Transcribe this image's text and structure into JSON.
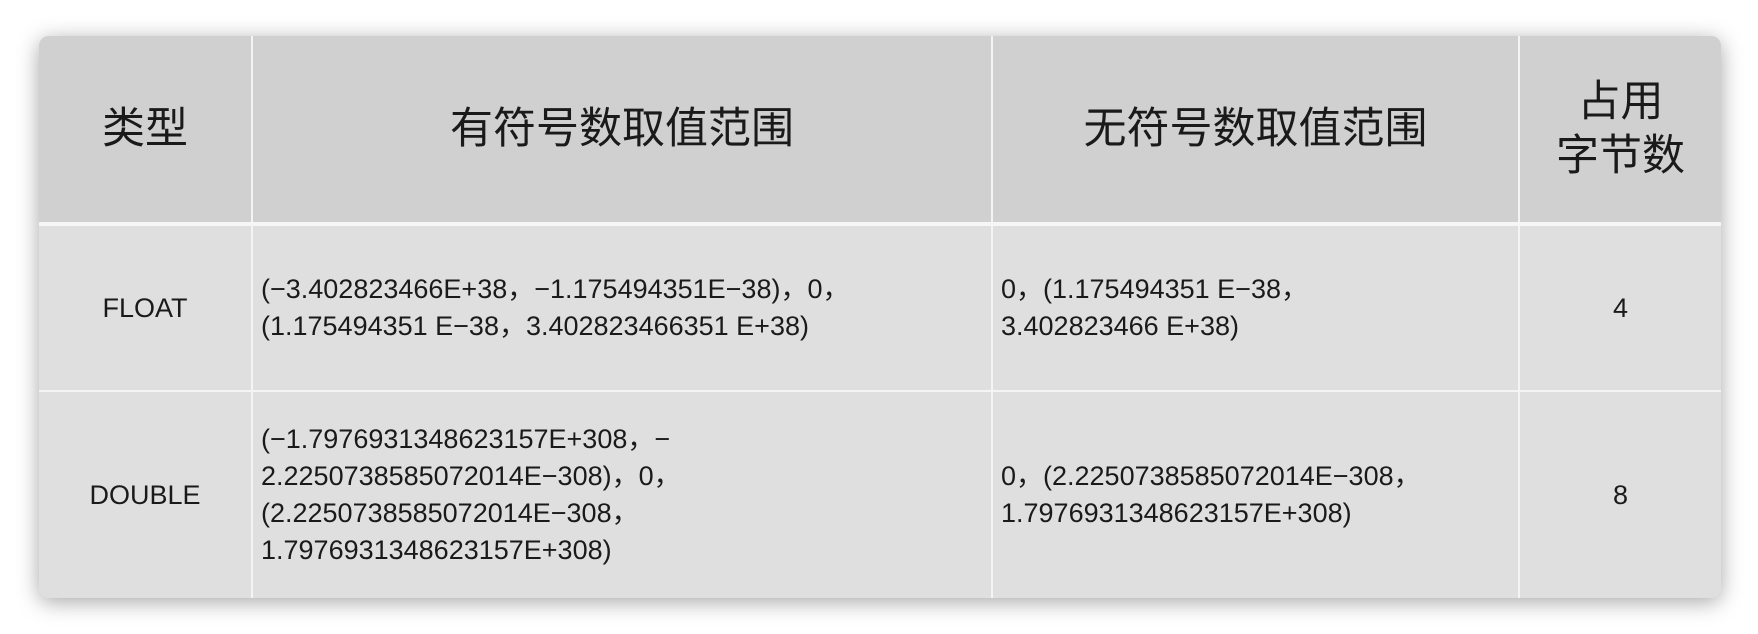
{
  "table": {
    "headers": [
      "类型",
      "有符号数取值范围",
      "无符号数取值范围",
      "占用\n字节数"
    ],
    "rows": [
      {
        "type": "FLOAT",
        "signed": "(−3.402823466E+38，−1.175494351E−38)，0，\n(1.175494351 E−38，3.402823466351 E+38)",
        "unsigned": "0，(1.175494351 E−38，\n3.402823466 E+38)",
        "bytes": "4"
      },
      {
        "type": "DOUBLE",
        "signed": "(−1.7976931348623157E+308，−\n2.2250738585072014E−308)，0，\n(2.2250738585072014E−308，\n1.7976931348623157E+308)",
        "unsigned": "0，(2.2250738585072014E−308，\n1.7976931348623157E+308)",
        "bytes": "8"
      }
    ]
  }
}
